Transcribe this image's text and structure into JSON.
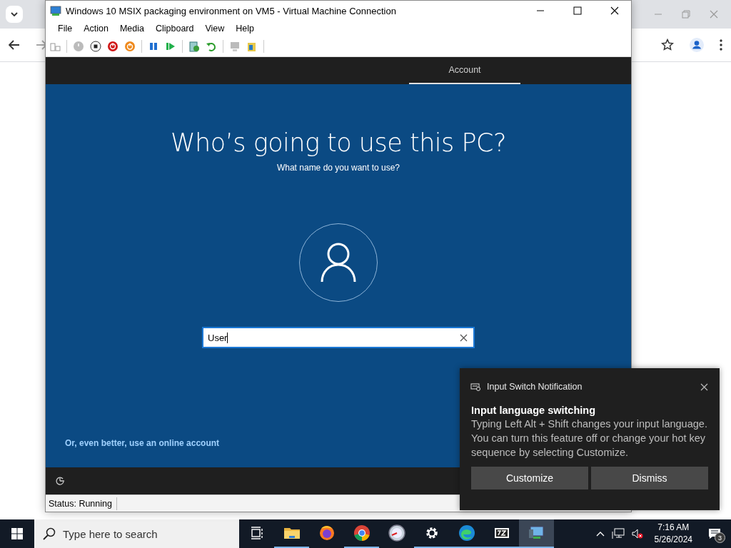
{
  "vm_window": {
    "title": "Windows 10 MSIX packaging environment on VM5 - Virtual Machine Connection",
    "menu": [
      "File",
      "Action",
      "Media",
      "Clipboard",
      "View",
      "Help"
    ],
    "status": "Status: Running"
  },
  "setup": {
    "tabs": [
      {
        "label": "Account",
        "selected": true
      }
    ],
    "heading": "Who’s going to use this PC?",
    "subheading": "What name do you want to use?",
    "name_field": {
      "value": "User"
    },
    "online_account_link": "Or, even better, use an online account"
  },
  "notification": {
    "app": "Input Switch Notification",
    "title": "Input language switching",
    "body": "Typing Left Alt + Shift changes your input language. You can turn this feature off or change your hot key sequence by selecting Customize.",
    "buttons": [
      "Customize",
      "Dismiss"
    ]
  },
  "taskbar": {
    "search": {
      "placeholder": "Type here to search"
    },
    "apps": [
      {
        "kind": "explorer",
        "running": true,
        "selected": false
      },
      {
        "kind": "firefox",
        "running": false,
        "selected": false
      },
      {
        "kind": "chrome",
        "running": true,
        "selected": false
      },
      {
        "kind": "gauge",
        "running": false,
        "selected": false
      },
      {
        "kind": "settings",
        "running": true,
        "selected": false
      },
      {
        "kind": "edge",
        "running": true,
        "selected": false
      },
      {
        "kind": "sevenzip",
        "running": true,
        "selected": false
      },
      {
        "kind": "vmconnect",
        "running": true,
        "selected": true
      }
    ],
    "time": "7:16 AM",
    "date": "5/26/2024",
    "notification_count": "3"
  }
}
